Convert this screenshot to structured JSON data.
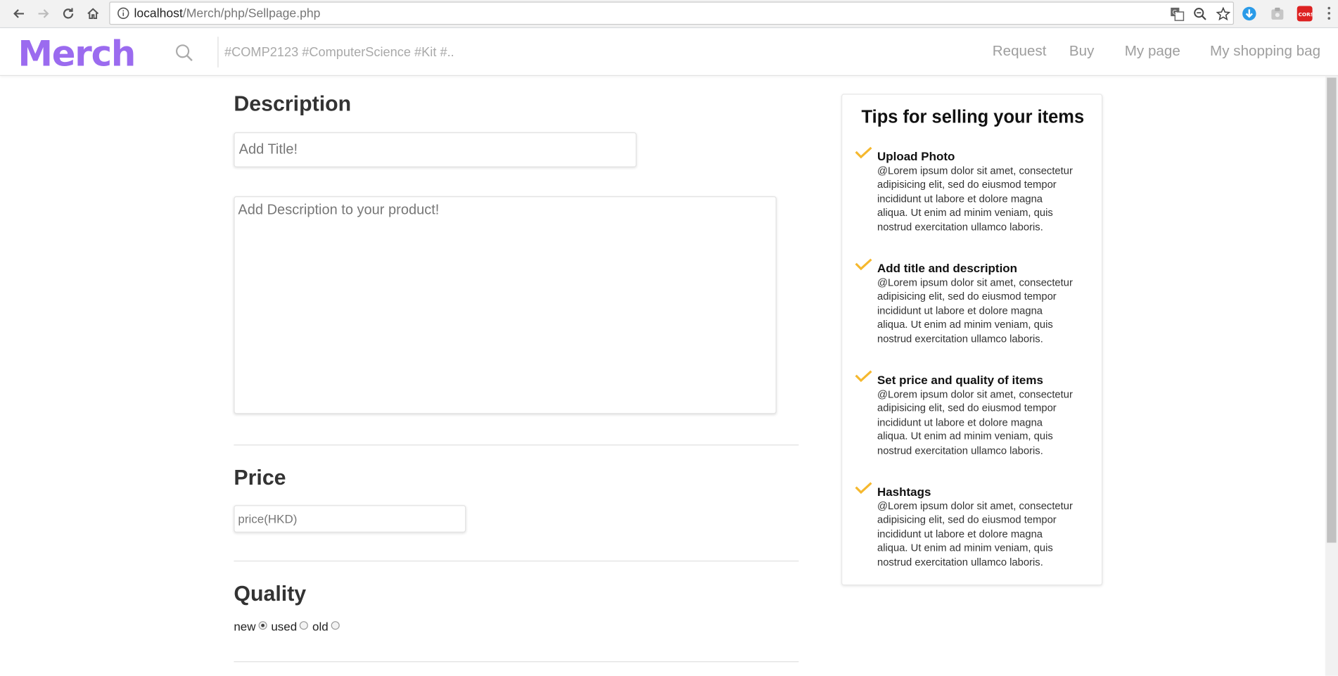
{
  "browser": {
    "url_host": "localhost",
    "url_path": "/Merch/php/Sellpage.php"
  },
  "header": {
    "logo": "Merch",
    "search_placeholder": "#COMP2123 #ComputerScience #Kit #..",
    "nav": [
      "Request",
      "Buy",
      "My page",
      "My shopping bag"
    ]
  },
  "form": {
    "description_heading": "Description",
    "title_placeholder": "Add Title!",
    "description_placeholder": "Add Description to your product!",
    "price_heading": "Price",
    "price_placeholder": "price(HKD)",
    "quality_heading": "Quality",
    "quality_options": [
      "new",
      "used",
      "old"
    ],
    "quality_selected": "new"
  },
  "tips": {
    "title": "Tips for selling your items",
    "items": [
      {
        "title": "Upload Photo",
        "text": "@Lorem ipsum dolor sit amet, consectetur adipisicing elit, sed do eiusmod tempor incididunt ut labore et dolore magna aliqua. Ut enim ad minim veniam, quis nostrud exercitation ullamco laboris."
      },
      {
        "title": "Add title and description",
        "text": "@Lorem ipsum dolor sit amet, consectetur adipisicing elit, sed do eiusmod tempor incididunt ut labore et dolore magna aliqua. Ut enim ad minim veniam, quis nostrud exercitation ullamco laboris."
      },
      {
        "title": "Set price and quality of items",
        "text": "@Lorem ipsum dolor sit amet, consectetur adipisicing elit, sed do eiusmod tempor incididunt ut labore et dolore magna aliqua. Ut enim ad minim veniam, quis nostrud exercitation ullamco laboris."
      },
      {
        "title": "Hashtags",
        "text": "@Lorem ipsum dolor sit amet, consectetur adipisicing elit, sed do eiusmod tempor incididunt ut labore et dolore magna aliqua. Ut enim ad minim veniam, quis nostrud exercitation ullamco laboris."
      }
    ]
  },
  "colors": {
    "brand": "#9b6bef",
    "check": "#f5b82e",
    "nav_text": "#9e9e9e"
  },
  "icons": [
    "back-icon",
    "forward-icon",
    "reload-icon",
    "home-icon",
    "info-icon",
    "translate-icon",
    "zoom-icon",
    "star-icon",
    "download-extension-icon",
    "clipboard-extension-icon",
    "cors-extension-icon",
    "menu-icon",
    "search-icon",
    "check-icon"
  ]
}
